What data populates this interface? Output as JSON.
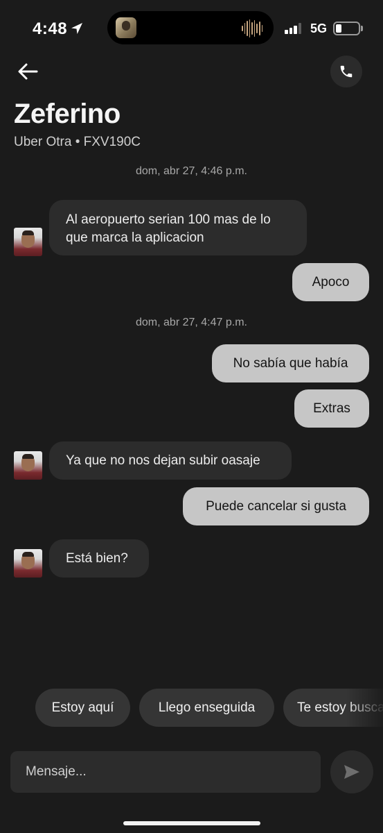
{
  "status_bar": {
    "time": "4:48",
    "network": "5G",
    "icons": [
      "location-arrow-icon",
      "waveform-icon",
      "signal-icon",
      "battery-icon"
    ]
  },
  "header": {
    "back_icon": "arrow-left-icon",
    "call_icon": "phone-icon",
    "contact_name": "Zeferino",
    "subtitle": "Uber Otra • FXV190C"
  },
  "chat": {
    "timestamps": [
      "dom, abr 27, 4:46 p.m.",
      "dom, abr 27, 4:47 p.m."
    ],
    "messages": [
      {
        "from": "driver",
        "text": "Al aeropuerto serian 100 mas de lo que marca la aplicacion"
      },
      {
        "from": "me",
        "text": "Apoco"
      },
      {
        "from": "me",
        "text": "No sabía que había"
      },
      {
        "from": "me",
        "text": "Extras"
      },
      {
        "from": "driver",
        "text": "Ya que no nos dejan subir oasaje"
      },
      {
        "from": "me",
        "text": "Puede cancelar si gusta"
      },
      {
        "from": "driver",
        "text": "Está bien?"
      }
    ]
  },
  "quick_replies": [
    "Estoy aquí",
    "Llego enseguida",
    "Te estoy buscando"
  ],
  "composer": {
    "placeholder": "Mensaje...",
    "value": "",
    "send_icon": "send-icon"
  },
  "colors": {
    "background": "#1b1b1b",
    "incoming_bubble": "#2c2c2c",
    "outgoing_bubble": "#c6c6c6",
    "chip": "#353535"
  }
}
